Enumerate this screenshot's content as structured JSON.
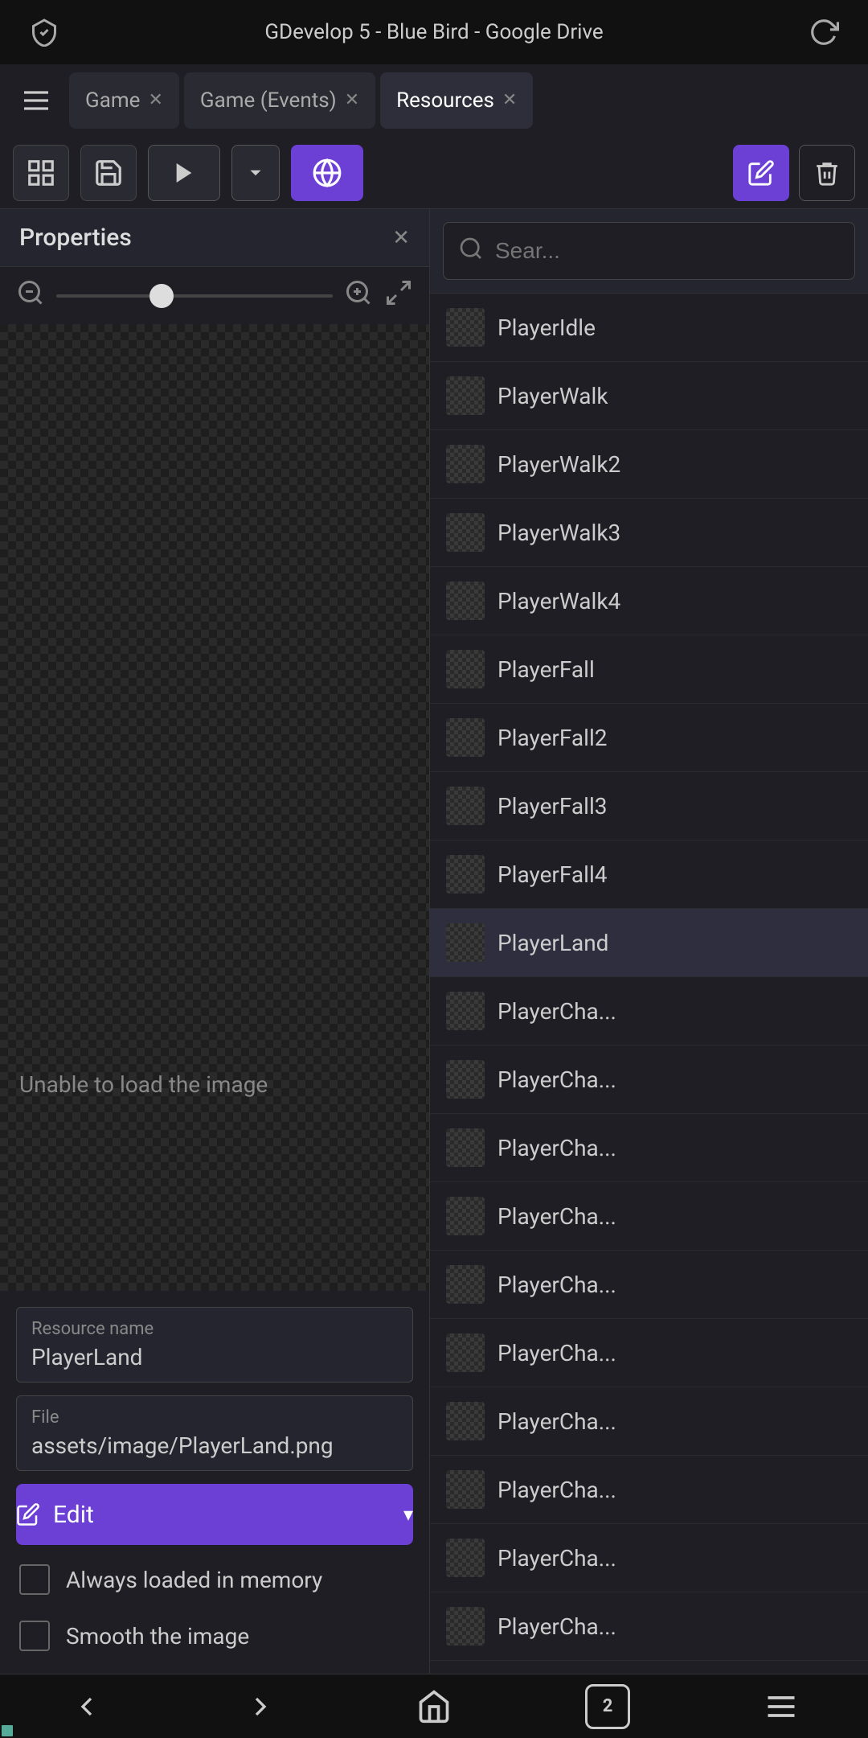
{
  "statusBar": {
    "title": "GDevelop 5 - Blue Bird - Google Drive",
    "refreshIcon": "↻"
  },
  "tabs": [
    {
      "label": "Game",
      "active": false
    },
    {
      "label": "Game (Events)",
      "active": false
    },
    {
      "label": "Resources",
      "active": true
    }
  ],
  "toolbar": {
    "gridToggleIcon": "▦",
    "saveIcon": "💾",
    "playIcon": "▶",
    "dropdownIcon": "▾",
    "globeIcon": "🌐",
    "editIcon": "✎",
    "deleteIcon": "🗑"
  },
  "propertiesPanel": {
    "title": "Properties",
    "closeIcon": "✕"
  },
  "zoom": {
    "minusIcon": "−",
    "plusIcon": "+",
    "expandIcon": "⤢"
  },
  "imageError": "Unable to load the image",
  "resourceForm": {
    "nameLabel": "Resource name",
    "nameValue": "PlayerLand",
    "fileLabel": "File",
    "fileValue": "assets/image/PlayerLand.png",
    "editButton": "Edit",
    "editIcon": "✎",
    "dropdownIcon": "▾",
    "alwaysLoadedLabel": "Always loaded in memory",
    "smoothImageLabel": "Smooth the image"
  },
  "searchBar": {
    "placeholder": "Sear...",
    "icon": "🔍"
  },
  "resources": [
    {
      "name": "PlayerIdle",
      "selected": false
    },
    {
      "name": "PlayerWalk",
      "selected": false
    },
    {
      "name": "PlayerWalk2",
      "selected": false
    },
    {
      "name": "PlayerWalk3",
      "selected": false
    },
    {
      "name": "PlayerWalk4",
      "selected": false
    },
    {
      "name": "PlayerFall",
      "selected": false
    },
    {
      "name": "PlayerFall2",
      "selected": false
    },
    {
      "name": "PlayerFall3",
      "selected": false
    },
    {
      "name": "PlayerFall4",
      "selected": false
    },
    {
      "name": "PlayerLand",
      "selected": true
    },
    {
      "name": "PlayerCha...",
      "selected": false
    },
    {
      "name": "PlayerCha...",
      "selected": false
    },
    {
      "name": "PlayerCha...",
      "selected": false
    },
    {
      "name": "PlayerCha...",
      "selected": false
    },
    {
      "name": "PlayerCha...",
      "selected": false
    },
    {
      "name": "PlayerCha...",
      "selected": false
    },
    {
      "name": "PlayerCha...",
      "selected": false
    },
    {
      "name": "PlayerCha...",
      "selected": false
    },
    {
      "name": "PlayerCha...",
      "selected": false
    },
    {
      "name": "PlayerCha...",
      "selected": false
    }
  ],
  "bottomNav": {
    "backIcon": "‹",
    "forwardIcon": "›",
    "homeIcon": "⌂",
    "tabCount": "2",
    "menuIcon": "≡"
  },
  "colors": {
    "accent": "#6c3fd5",
    "selectedBg": "#2e2e3f",
    "panelBg": "#1e1e24"
  }
}
